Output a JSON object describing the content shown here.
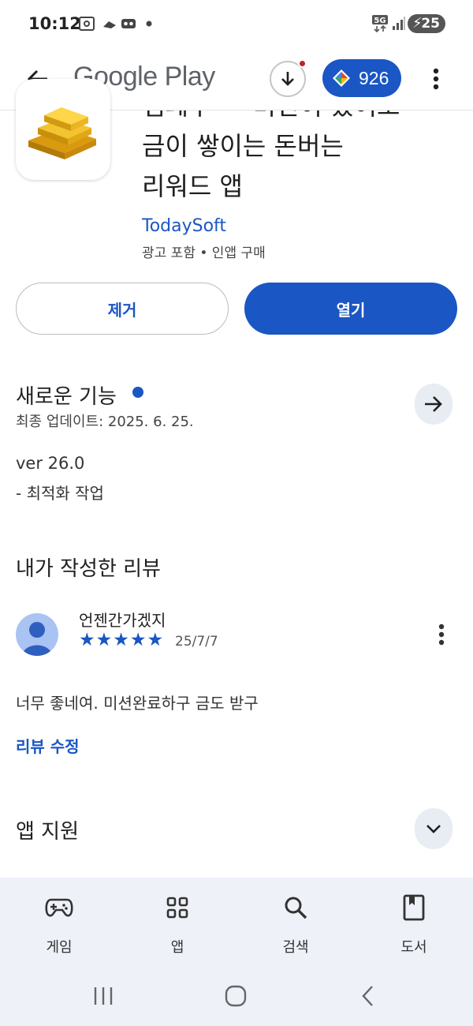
{
  "status_bar": {
    "time": "10:12",
    "network": "5G",
    "battery": "25"
  },
  "top_bar": {
    "brand": "Google Play",
    "points": "926"
  },
  "app": {
    "title_line_clipped": "엠페루 ― 미션이 있어도",
    "title_line_2": "금이 쌓이는 돈버는",
    "title_line_3": "리워드 앱",
    "developer": "TodaySoft",
    "meta": "광고 포함 • 인앱 구매"
  },
  "actions": {
    "uninstall_label": "제거",
    "open_label": "열기"
  },
  "whats_new": {
    "title": "새로운 기능",
    "updated": "최종 업데이트: 2025. 6. 25.",
    "version": "ver 26.0",
    "note": "- 최적화 작업"
  },
  "my_review": {
    "section_title": "내가 작성한 리뷰",
    "reviewer": "언젠간가겠지",
    "rating": 5,
    "stars": [
      "★",
      "★",
      "★",
      "★",
      "★"
    ],
    "date": "25/7/7",
    "text": "너무 좋네여. 미션완료하구 금도 받구",
    "edit_label": "리뷰 수정"
  },
  "app_support": {
    "title": "앱 지원"
  },
  "bottom_nav": {
    "items": [
      {
        "label": "게임",
        "icon": "gamepad-icon"
      },
      {
        "label": "앱",
        "icon": "apps-grid-icon"
      },
      {
        "label": "검색",
        "icon": "search-icon"
      },
      {
        "label": "도서",
        "icon": "book-icon"
      }
    ]
  },
  "colors": {
    "accent": "#1a56c4",
    "nav_bg": "#eef1f8"
  }
}
